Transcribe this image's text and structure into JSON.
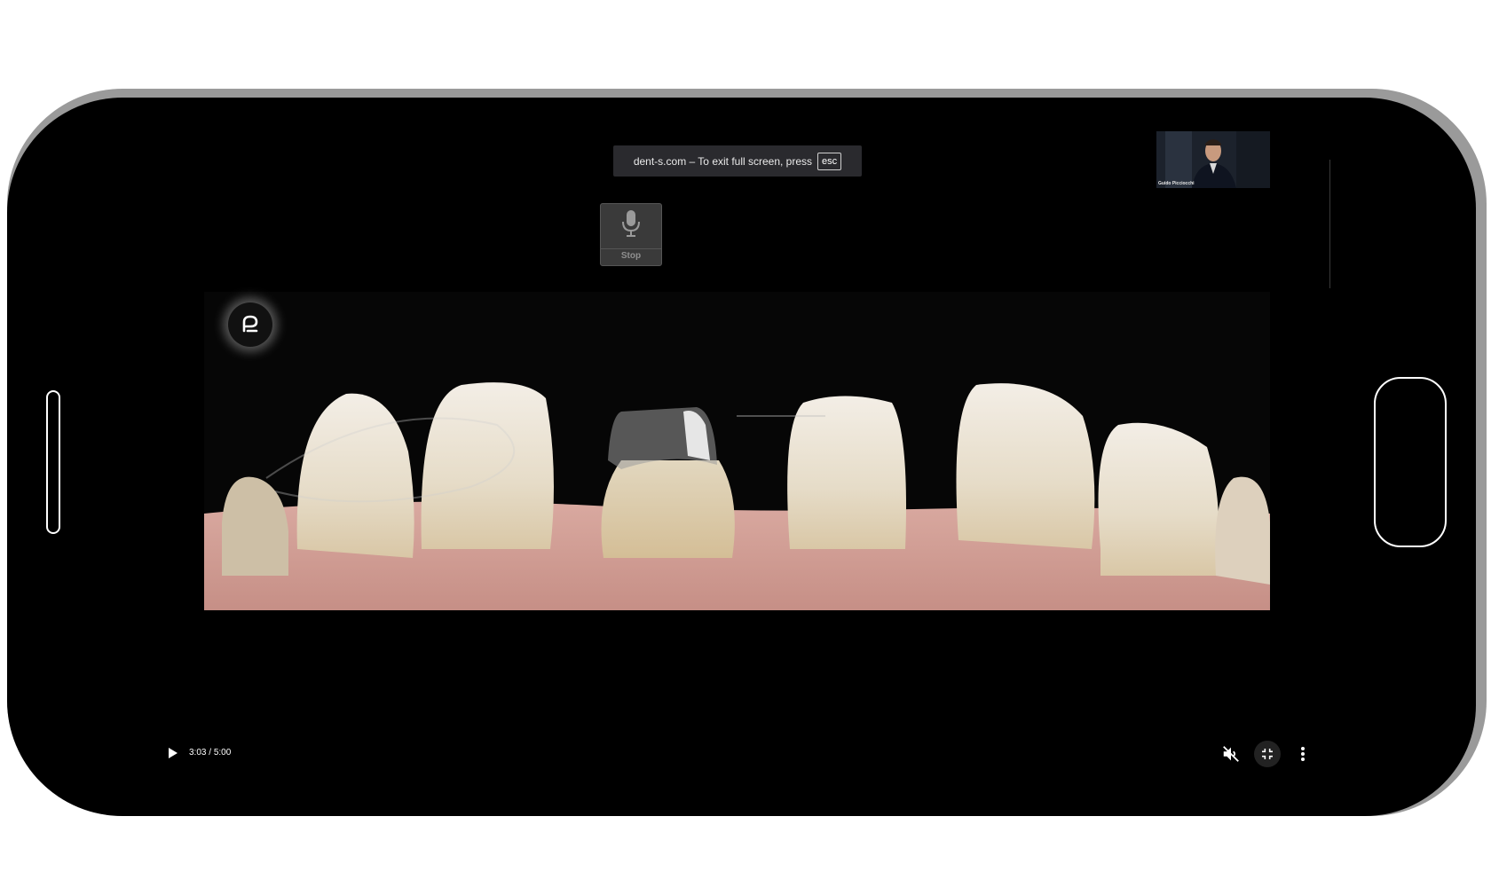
{
  "toast": {
    "message": "dent-s.com – To exit full screen, press",
    "key": "esc"
  },
  "mic": {
    "label": "Stop"
  },
  "pip": {
    "name": "Guido Picciocchi"
  },
  "video": {
    "current_time": "3:03",
    "separator": " / ",
    "duration": "5:00",
    "muted": true
  },
  "icons": {
    "play": "play-icon",
    "mute": "volume-off-icon",
    "exit_fullscreen": "fullscreen-exit-icon",
    "more": "more-vert-icon",
    "mic": "microphone-icon",
    "logo": "channel-logo-icon"
  }
}
